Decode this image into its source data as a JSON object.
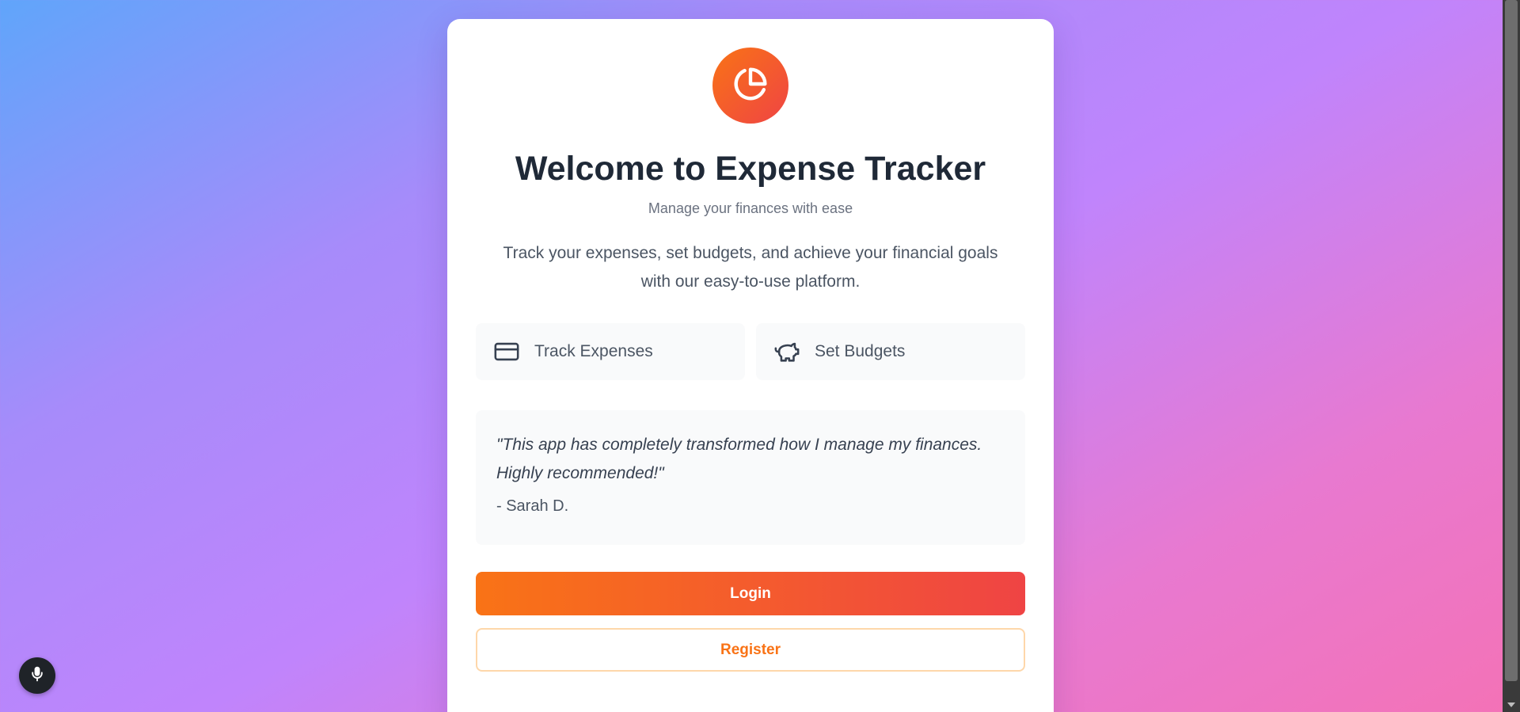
{
  "card": {
    "title": "Welcome to Expense Tracker",
    "subtitle": "Manage your finances with ease",
    "description": "Track your expenses, set budgets, and achieve your financial goals with our easy-to-use platform.",
    "logo_icon": "pie-chart-icon"
  },
  "features": [
    {
      "label": "Track Expenses",
      "icon": "credit-card-icon"
    },
    {
      "label": "Set Budgets",
      "icon": "piggy-bank-icon"
    }
  ],
  "testimonial": {
    "quote": "\"This app has completely transformed how I manage my finances. Highly recommended!\"",
    "author": "- Sarah D."
  },
  "buttons": {
    "login_label": "Login",
    "register_label": "Register"
  },
  "floating": {
    "icon": "microphone-icon"
  },
  "colors": {
    "accent_start": "#f97316",
    "accent_end": "#ef4444",
    "background_start": "#60a5fa",
    "background_end": "#f472b6"
  }
}
